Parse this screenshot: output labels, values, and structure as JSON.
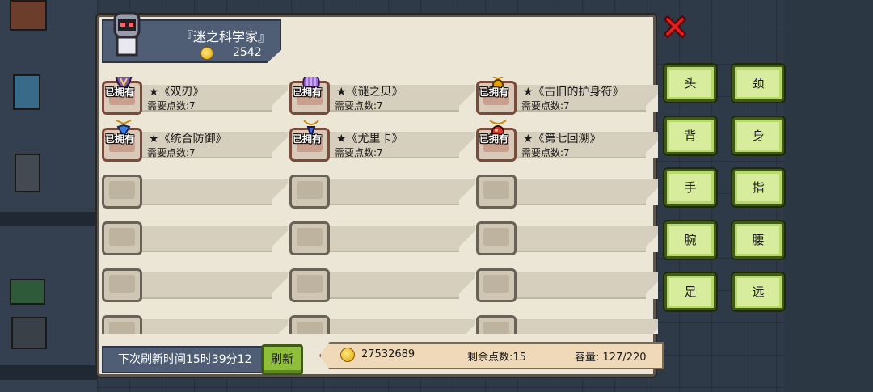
{
  "header": {
    "title": "『迷之科学家』",
    "gold": "2542"
  },
  "items": [
    {
      "name": "★《双刃》",
      "cost": "需要点数:7",
      "owned": true,
      "owned_label": "已拥有",
      "icon_color": "#7c59a8",
      "icon": "twin-blades-icon"
    },
    {
      "name": "★《谜之贝》",
      "cost": "需要点数:7",
      "owned": true,
      "owned_label": "已拥有",
      "icon_color": "#9b6fd4",
      "icon": "shell-icon"
    },
    {
      "name": "★《古旧的护身符》",
      "cost": "需要点数:7",
      "owned": true,
      "owned_label": "已拥有",
      "icon_color": "#e6a400",
      "icon": "amulet-icon"
    },
    {
      "name": "★《统合防御》",
      "cost": "需要点数:7",
      "owned": true,
      "owned_label": "已拥有",
      "icon_color": "#3e7de0",
      "icon": "shield-icon"
    },
    {
      "name": "★《尤里卡》",
      "cost": "需要点数:7",
      "owned": true,
      "owned_label": "已拥有",
      "icon_color": "#4a66e0",
      "icon": "necklace-icon"
    },
    {
      "name": "★《第七回溯》",
      "cost": "需要点数:7",
      "owned": true,
      "owned_label": "已拥有",
      "icon_color": "#d63a2a",
      "icon": "red-gem-icon"
    }
  ],
  "footer": {
    "timer": "下次刷新时间15时39分12",
    "refresh_label": "刷新",
    "gold": "27532689",
    "points": "剩余点数:15",
    "capacity": "容量: 127/220"
  },
  "categories": [
    "头",
    "颈",
    "背",
    "身",
    "手",
    "指",
    "腕",
    "腰",
    "足",
    "远"
  ],
  "colors": {
    "panel": "#ece6d6",
    "header": "#4f5d75",
    "button": "#d7ec9c",
    "close": "#e02020"
  }
}
